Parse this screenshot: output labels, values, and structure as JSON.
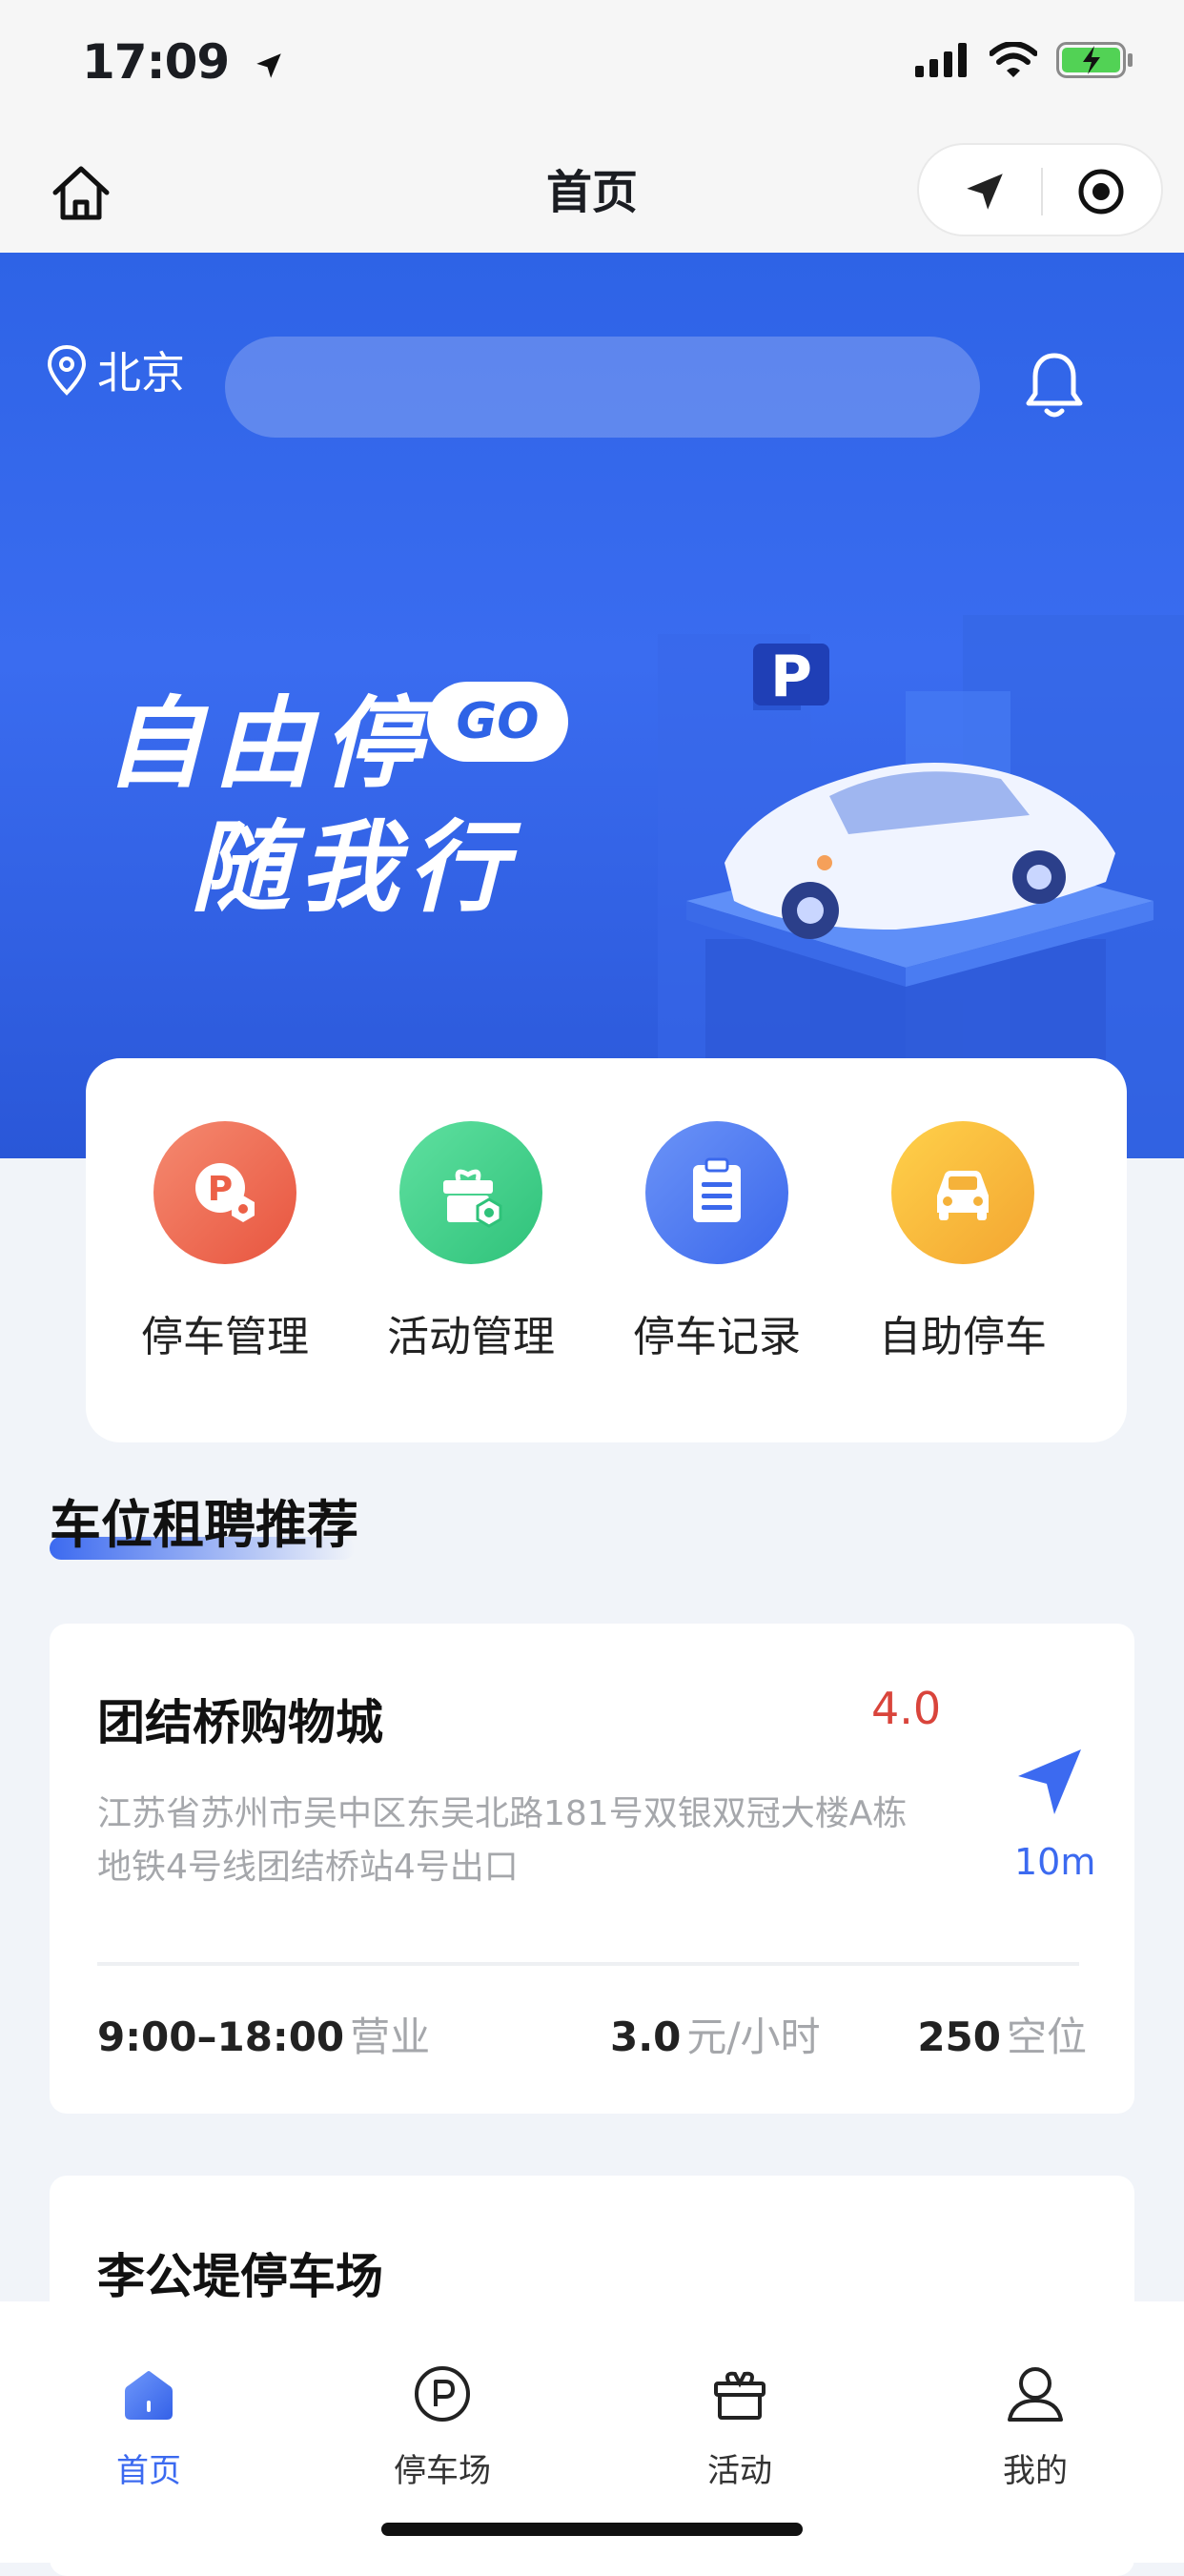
{
  "status_bar": {
    "time": "17:09"
  },
  "nav": {
    "title": "首页"
  },
  "banner": {
    "city": "北京",
    "search_placeholder": "",
    "slogan_line1": "自由停",
    "badge": "GO",
    "slogan_line2": "随我行"
  },
  "quick_actions": [
    {
      "label": "停车管理",
      "icon": "parking-manage-icon",
      "color": "#ef6a57"
    },
    {
      "label": "活动管理",
      "icon": "activity-manage-icon",
      "color": "#3fcf88"
    },
    {
      "label": "停车记录",
      "icon": "parking-record-icon",
      "color": "#4a78f0"
    },
    {
      "label": "自助停车",
      "icon": "self-parking-icon",
      "color": "#f5b23a"
    }
  ],
  "section": {
    "title": "车位租聘推荐"
  },
  "lots": [
    {
      "name": "团结桥购物城",
      "rating": "4.0",
      "address": "江苏省苏州市吴中区东吴北路181号双银双冠大楼A栋地铁4号线团结桥站4号出口",
      "distance": "10m",
      "hours": "9:00–18:00",
      "hours_unit": "营业",
      "price": "3.0",
      "price_unit": "元/小时",
      "spaces": "250",
      "spaces_unit": "空位"
    },
    {
      "name": "李公堤停车场"
    }
  ],
  "tabs": [
    {
      "label": "首页",
      "active": true
    },
    {
      "label": "停车场",
      "active": false
    },
    {
      "label": "活动",
      "active": false
    },
    {
      "label": "我的",
      "active": false
    }
  ],
  "colors": {
    "primary": "#3c6af0",
    "rating": "#d9443b"
  }
}
